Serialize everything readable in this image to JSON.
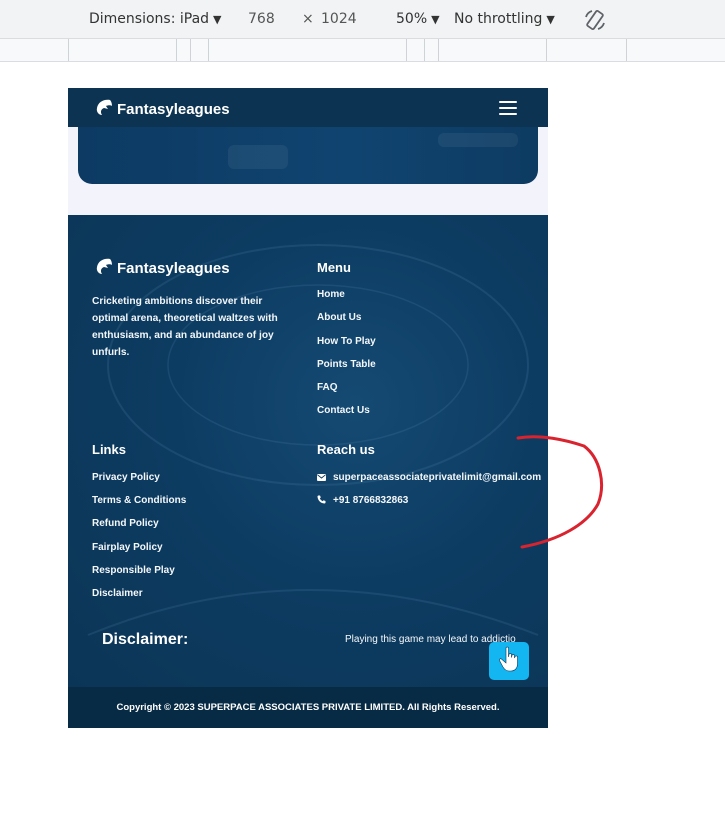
{
  "devtools": {
    "dimensions_label": "Dimensions: iPad",
    "width": "768",
    "times": "×",
    "height": "1024",
    "zoom": "50%",
    "throttling": "No throttling",
    "rotate_icon": "rotate-icon"
  },
  "site": {
    "brand": "Fantasyleagues",
    "menu_icon": "hamburger-icon",
    "footer": {
      "brand": "Fantasyleagues",
      "description": "Cricketing ambitions discover their optimal arena, theoretical waltzes with enthusiasm, and an abundance of joy unfurls.",
      "menu": {
        "title": "Menu",
        "items": [
          "Home",
          "About Us",
          "How To Play",
          "Points Table",
          "FAQ",
          "Contact Us"
        ]
      },
      "links": {
        "title": "Links",
        "items": [
          "Privacy Policy",
          "Terms & Conditions",
          "Refund Policy",
          "Fairplay Policy",
          "Responsible Play",
          "Disclaimer"
        ]
      },
      "reach": {
        "title": "Reach us",
        "email": "superpaceassociateprivatelimit@gmail.com",
        "phone": "+91 8766832863"
      },
      "disclaimer": {
        "title": "Disclaimer:",
        "text": "Playing this game may lead to addiction"
      },
      "copyright": "Copyright © 2023 SUPERPACE ASSOCIATES PRIVATE LIMITED.  All Rights Reserved."
    }
  },
  "colors": {
    "header_bg": "#0c3452",
    "footer_bg": "#0b3556",
    "copyright_bg": "#082b45",
    "touch_button": "#14b6f2",
    "annotation": "#d9232e"
  }
}
